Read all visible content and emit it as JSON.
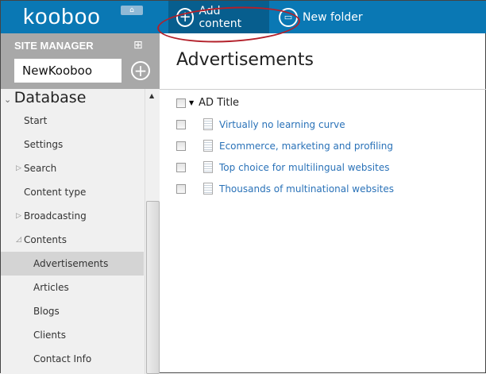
{
  "topbar": {
    "logo": "kooboo",
    "home_icon": "home-icon",
    "add_content": "Add content",
    "new_folder": "New folder"
  },
  "sidebar": {
    "title": "SITE MANAGER",
    "site_name": "NewKooboo",
    "root": "Database",
    "items": [
      {
        "label": "Start",
        "level": 1,
        "toggle": ""
      },
      {
        "label": "Settings",
        "level": 1,
        "toggle": ""
      },
      {
        "label": "Search",
        "level": 1,
        "toggle": "▷"
      },
      {
        "label": "Content type",
        "level": 1,
        "toggle": ""
      },
      {
        "label": "Broadcasting",
        "level": 1,
        "toggle": "▷"
      },
      {
        "label": "Contents",
        "level": 1,
        "toggle": "◿"
      },
      {
        "label": "Advertisements",
        "level": 2,
        "toggle": "",
        "active": true
      },
      {
        "label": "Articles",
        "level": 2,
        "toggle": ""
      },
      {
        "label": "Blogs",
        "level": 2,
        "toggle": ""
      },
      {
        "label": "Clients",
        "level": 2,
        "toggle": ""
      },
      {
        "label": "Contact Info",
        "level": 2,
        "toggle": ""
      }
    ]
  },
  "main": {
    "title": "Advertisements",
    "column": "AD Title",
    "rows": [
      "Virtually no learning curve",
      "Ecommerce, marketing and profiling",
      "Top choice for multilingual websites",
      "Thousands of multinational websites"
    ]
  }
}
